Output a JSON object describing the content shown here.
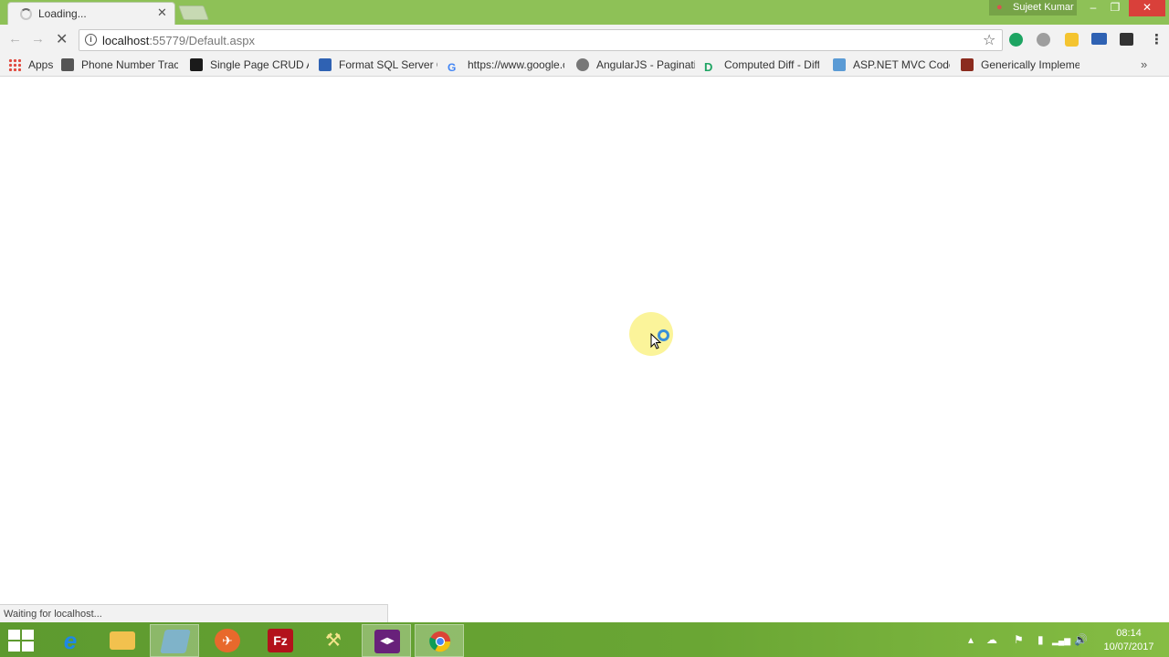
{
  "tab": {
    "title": "Loading...",
    "close": "✕"
  },
  "window": {
    "user": "Sujeet Kumar",
    "minimize": "–",
    "maximize": "❐",
    "close": "✕"
  },
  "toolbar": {
    "back": "←",
    "forward": "→",
    "stop": "✕",
    "star": "☆",
    "menu": "⋮"
  },
  "address": {
    "host": "localhost",
    "path": ":55779/Default.aspx"
  },
  "bookmarks": {
    "items": [
      {
        "label": "Apps",
        "icon": "apps-grid-icon"
      },
      {
        "label": "Phone Number Track",
        "icon": "page-icon",
        "color": "#555555"
      },
      {
        "label": "Single Page CRUD Ap",
        "icon": "site-icon",
        "color": "#1a1a1a"
      },
      {
        "label": "Format SQL Server Q",
        "icon": "sql-icon",
        "color": "#2f62b3"
      },
      {
        "label": "https://www.google.c",
        "icon": "google-icon",
        "color": "#4285f4"
      },
      {
        "label": "AngularJS - Paginatio",
        "icon": "user-icon",
        "color": "#777777"
      },
      {
        "label": "Computed Diff - Diff",
        "icon": "diff-icon",
        "color": "#1da462"
      },
      {
        "label": "ASP.NET MVC Code F",
        "icon": "aspnet-icon",
        "color": "#5b9bd5"
      },
      {
        "label": "Generically Implemer",
        "icon": "book-icon",
        "color": "#8b2b1e"
      }
    ],
    "more": "»"
  },
  "status": "Waiting for localhost...",
  "taskbar": {
    "apps": [
      {
        "name": "internet-explorer",
        "glyph": "e",
        "color": "#1e88e5"
      },
      {
        "name": "file-explorer",
        "glyph": "",
        "color": "#f2c14e"
      },
      {
        "name": "notepad",
        "glyph": "",
        "color": "#7fb3c9"
      },
      {
        "name": "rocket-app",
        "glyph": "✈",
        "color": "#e8692c"
      },
      {
        "name": "filezilla",
        "glyph": "Fz",
        "color": "#b3121b"
      },
      {
        "name": "tools",
        "glyph": "⚒",
        "color": "#d8b73a"
      },
      {
        "name": "visual-studio",
        "glyph": "◀▶",
        "color": "#68217a"
      },
      {
        "name": "chrome",
        "glyph": "",
        "color": "#ffffff"
      }
    ],
    "clock": {
      "time": "08:14",
      "date": "10/07/2017"
    },
    "tray": [
      "▴",
      "☁",
      "⚑",
      "▮",
      "▂▄▆",
      "🔊"
    ]
  }
}
